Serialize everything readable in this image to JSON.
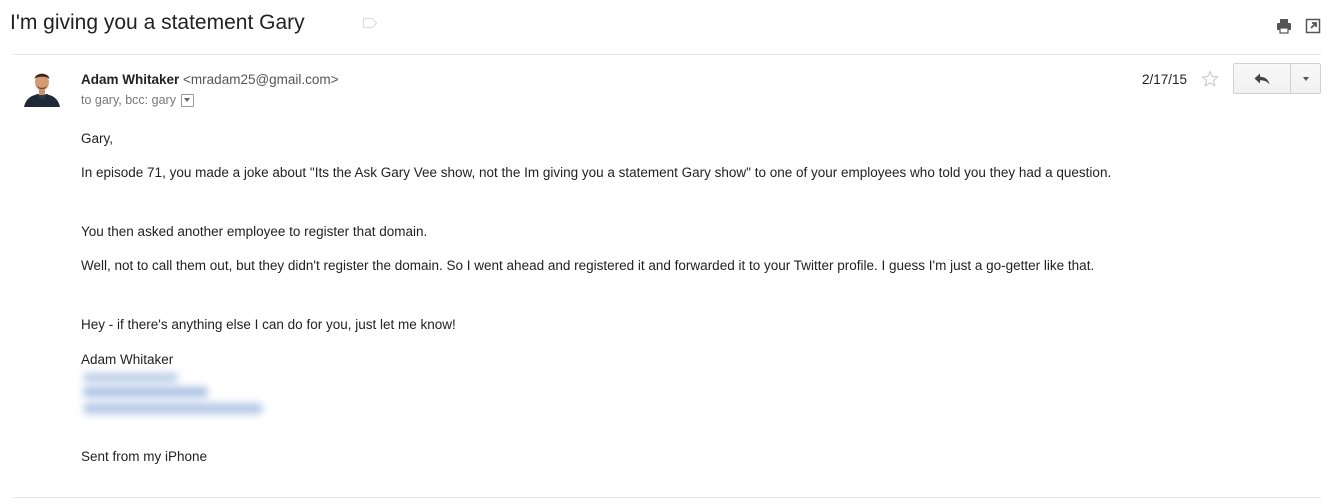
{
  "email": {
    "subject": "I'm giving you a statement Gary",
    "sender": {
      "name": "Adam Whitaker",
      "email": "<mradam25@gmail.com>"
    },
    "recipients": "to gary, bcc: gary",
    "date": "2/17/15",
    "body": {
      "greeting": "Gary,",
      "paragraph_1": "In episode 71, you made a joke about \"Its the Ask Gary Vee show, not the Im giving you a statement Gary show\" to one of your employees who told you they had a question.",
      "paragraph_2": "You then asked another employee to register that domain.",
      "paragraph_3": "Well, not to call them out, but they didn't register the domain. So I went ahead and registered it and forwarded it to your Twitter profile. I guess I'm just a go-getter like that.",
      "paragraph_4": "Hey - if there's anything else I can do for you, just let me know!",
      "signature_name": "Adam Whitaker",
      "sent_from": "Sent from my iPhone"
    }
  },
  "icons": {
    "label": "label-tag-icon",
    "print": "print-icon",
    "new_window": "new-window-icon",
    "star": "star-icon",
    "reply": "reply-arrow-icon",
    "more": "chevron-down-icon",
    "recipients_toggle": "chevron-down-icon"
  },
  "colors": {
    "text": "#222222",
    "secondary_text": "#777777",
    "divider": "#e5e5e5",
    "button_border": "#d0d0d0"
  }
}
